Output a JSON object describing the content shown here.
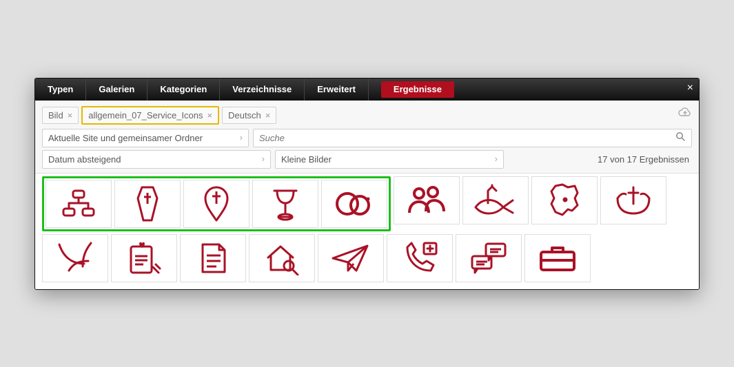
{
  "tabs": {
    "typen": "Typen",
    "galerien": "Galerien",
    "kategorien": "Kategorien",
    "verzeichnisse": "Verzeichnisse",
    "erweitert": "Erweitert",
    "ergebnisse": "Ergebnisse"
  },
  "chips": {
    "bild": "Bild",
    "gallery": "allgemein_07_Service_Icons",
    "lang": "Deutsch"
  },
  "combos": {
    "site": "Aktuelle Site und gemeinsamer Ordner",
    "sort": "Datum absteigend",
    "size": "Kleine Bilder"
  },
  "search": {
    "placeholder": "Suche"
  },
  "results_count": "17 von 17 Ergebnissen",
  "icons": {
    "stroke": "#a91226",
    "row1": [
      "org-chart",
      "coffin",
      "pin-cross",
      "chalice",
      "rings",
      "people",
      "church-fish",
      "region-map",
      "hands-cross"
    ],
    "row2": [
      "branch",
      "contract-heart",
      "note",
      "house-search",
      "paper-plane",
      "phone-plus",
      "chat-bubbles",
      "briefcase"
    ]
  }
}
